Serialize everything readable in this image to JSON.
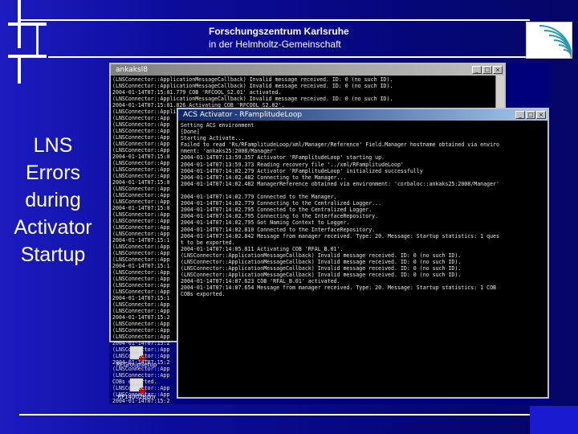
{
  "header": {
    "org_name": "Forschungszentrum Karlsruhe",
    "org_subtitle": "in der Helmholtz-Gemeinschaft"
  },
  "slide": {
    "title": "LNS Errors during Activator Startup"
  },
  "desktop": {
    "icons": [
      {
        "label": "RFGroupSetup"
      },
      {
        "label": "RF14002Bdm"
      }
    ]
  },
  "console_back": {
    "title": "ankaksl8",
    "lines": [
      "(LNSConnector::ApplicationMessageCallback) Invalid message received. ID: 0 (no such ID).",
      "(LNSConnector::ApplicationMessageCallback) Invalid message received. ID: 0 (no such ID).",
      "2004-01-14T07:15:01.779 COB 'RFCOOL_S2.01' activated.",
      "(LNSConnector::ApplicationMessageCallback) Invalid message received. ID: 0 (no such ID).",
      "2004-01-14T07:15:01.826 Activating COB 'RFCOOL_S2.02'.",
      "(LNSConnector::ApplicationMessageCallback) Invalid message received. ID: 0 (no such ID).",
      "(LNSConnector::App",
      "(LNSConnector::App",
      "(LNSConnector::App",
      "(LNSConnector::App",
      "(LNSConnector::App",
      "(LNSConnector::App",
      "2004-01-14T07:15:0",
      "(LNSConnector::App",
      "(LNSConnector::App",
      "(LNSConnector::App",
      "2004-01-14T07:15:0",
      "(LNSConnector::App",
      "(LNSConnector::App",
      "(LNSConnector::App",
      "2004-01-14T07:15:0",
      "(LNSConnector::App",
      "(LNSConnector::App",
      "(LNSConnector::App",
      "(LNSConnector::App",
      "2004-01-14T07:15:1",
      "(LNSConnector::App",
      "(LNSConnector::App",
      "(LNSConnector::App",
      "2004-01-14T07:15:1",
      "(LNSConnector::App",
      "(LNSConnector::App",
      "(LNSConnector::App",
      "(LNSConnector::App",
      "2004-01-14T07:15:1",
      "(LNSConnector::App",
      "(LNSConnector::App",
      "2004-01-14T07:15:2",
      "(LNSConnector::App",
      "(LNSConnector::App",
      "(LNSConnector::App",
      "2004-01-14T07:15:2",
      "(LNSConnector::App",
      "(LNSConnector::App",
      "2004-01-14T07:15:2",
      "(LNSConnector::App",
      "(LNSConnector::App",
      "COBs exported.",
      "(LNSConnector::App",
      "(LNSConnector::App",
      "2004-01-14T07:15:2"
    ]
  },
  "console_front": {
    "title": "ACS Activator - RFamplitudeLoop",
    "lines": [
      "Setting ACS environment",
      "[Done]",
      "Starting Activate...",
      "Failed to read 'Rs/RFamplitudeLoop/xml/Manager/Reference' Field.Manager hostname obtained via enviro",
      "nment: 'ankaks25:2008/Manager'",
      "2004-01-14T07:13:59.357 Activator 'RFamplitudeLoop' starting up.",
      "2004-01-14T07:13:59.373 Reading recovery file '../xml/RFamplitudeLoop'",
      "2004-01-14T07:14:02.279 Activator 'RFamplitudeLoop' initialized successfully",
      "2004-01-14T07:14:02.482 Connecting to the Manager...",
      "2004-01-14T07:14:02.482 ManagerReference obtained via environment: 'corbaloc::ankaks25:2008/Manager'",
      "",
      "2004-01-14T07:14:02.779 Connected to the Manager.",
      "2004-01-14T07:14:02.779 Connecting to the Centralized Logger...",
      "2004-01-14T07:14:02.795 Connected to the Centralized Logger.",
      "2004-01-14T07:14:02.795 Connecting to the InterfaceRepository.",
      "2004-01-14T07:14:02.795 Got Naming Context to Logger.",
      "2004-01-14T07:14:02.810 Connected to the InterfaceRepository.",
      "2004-01-14T07:14:02.842 Message from manager received. Type: 20. Message: Startup statistics: 1 ques",
      "t to be exported.",
      "2004-01-14T07:14:05.811 Activating COB 'RFAL_B.01'.",
      "(LNSConnector::ApplicationMessageCallback) Invalid message received. ID: 0 (no such ID).",
      "(LNSConnector::ApplicationMessageCallback) Invalid message received. ID: 0 (no such ID).",
      "(LNSConnector::ApplicationMessageCallback) Invalid message received. ID: 0 (no such ID).",
      "(LNSConnector::ApplicationMessageCallback) Invalid message received. ID: 0 (no such ID).",
      "2004-01-14T07:14:07.623 COB 'RFAL_B.01' activated.",
      "2004-01-14T07:14:07.654 Message from manager received. Type: 20. Message: Startup statistics: 1 COB",
      "COBs exported."
    ]
  }
}
